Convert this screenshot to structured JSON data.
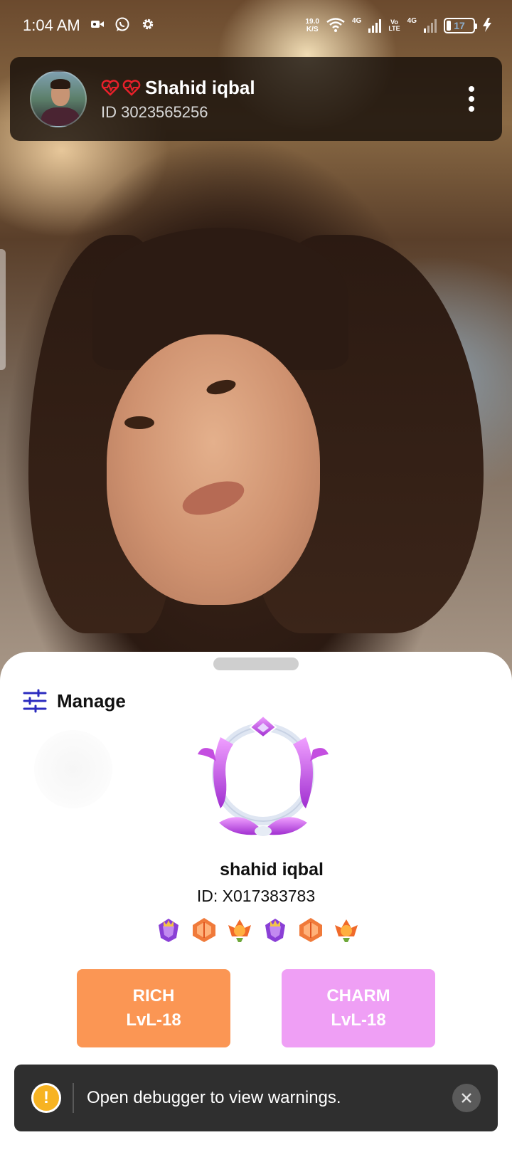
{
  "status_bar": {
    "time": "1:04 AM",
    "net_speed_value": "19.0",
    "net_speed_unit": "K/S",
    "network_1": "4G",
    "volte_top": "Vo",
    "volte_bottom": "LTE",
    "network_2": "4G",
    "battery_level": "17",
    "battery_fraction": 0.17,
    "icons": [
      "video-icon",
      "whatsapp-icon",
      "settings-icon",
      "wifi-icon",
      "signal-icon",
      "battery-icon",
      "charging-icon"
    ]
  },
  "header": {
    "name": "Shahid iqbal",
    "id_text": "ID 3023565256",
    "icons": [
      "heartbeat-icon",
      "heartbeat-icon",
      "more-vertical-icon"
    ],
    "heart_color": "#e8202a"
  },
  "sheet": {
    "manage_label": "Manage",
    "profile_name": "shahid iqbal",
    "profile_id": "ID: X017383783",
    "badges": [
      "crown-badge-purple",
      "gift-box-badge-orange",
      "flame-badge-orange",
      "crown-badge-purple",
      "gift-box-badge-orange",
      "flame-badge-orange"
    ],
    "rich": {
      "title": "RICH",
      "level": "LvL-18",
      "color": "#fb9654"
    },
    "charm": {
      "title": "CHARM",
      "level": "LvL-18",
      "color": "#ef9ff5"
    },
    "manage_icon_color": "#2b2bbf"
  },
  "toast": {
    "message": "Open debugger to view warnings.",
    "warning_symbol": "!",
    "accent": "#f7b322"
  }
}
